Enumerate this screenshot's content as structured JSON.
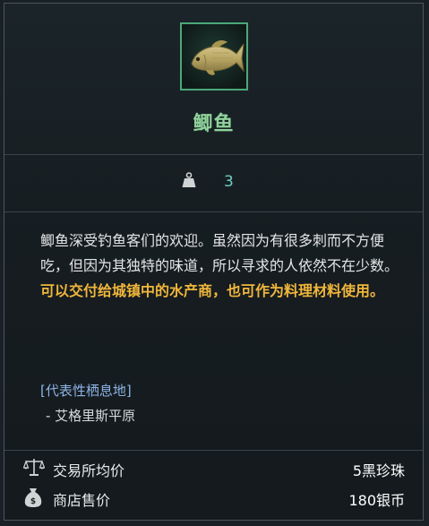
{
  "item": {
    "name": "鲫鱼",
    "icon": "crucian-carp-fish-icon",
    "rarity_color": "#4ca879"
  },
  "weight": {
    "icon": "weight-icon",
    "value": "3"
  },
  "description": {
    "text": "鲫鱼深受钓鱼客们的欢迎。虽然因为有很多刺而不方便吃，但因为其独特的味道，所以寻求的人依然不在少数。",
    "highlight": "可以交付给城镇中的水产商，也可作为料理材料使用。"
  },
  "habitat": {
    "title": "[代表性栖息地]",
    "items": [
      "- 艾格里斯平原"
    ]
  },
  "prices": {
    "market": {
      "icon": "scales-icon",
      "label": "交易所均价",
      "value": "5黑珍珠"
    },
    "shop": {
      "icon": "money-bag-icon",
      "label": "商店售价",
      "value": "180银币"
    }
  }
}
